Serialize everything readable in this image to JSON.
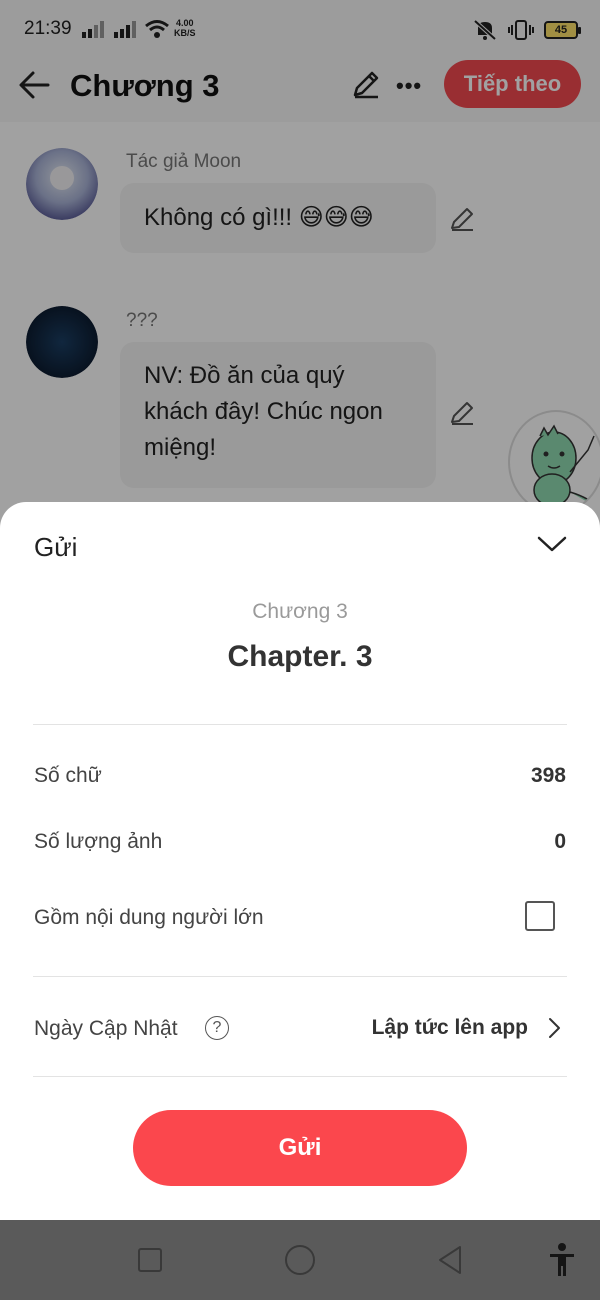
{
  "status_bar": {
    "time": "21:39",
    "net_speed_value": "4.00",
    "net_speed_unit": "KB/S",
    "battery": "45"
  },
  "top_bar": {
    "title": "Chương 3",
    "next_label": "Tiếp theo"
  },
  "messages": [
    {
      "author": "Tác giả Moon",
      "text": "Không có gì!!! 😅😅😅"
    },
    {
      "author": "???",
      "text": "NV: Đồ ăn của quý khách đây! Chúc ngon miệng!"
    }
  ],
  "sheet": {
    "title": "Gửi",
    "chapter_subtitle": "Chương 3",
    "chapter_title": "Chapter. 3",
    "word_count_label": "Số chữ",
    "word_count_value": "398",
    "image_count_label": "Số lượng ảnh",
    "image_count_value": "0",
    "adult_content_label": "Gồm nội dung người lớn",
    "adult_content_checked": false,
    "update_date_label": "Ngày Cập Nhật",
    "update_date_value": "Lập tức lên app",
    "help_glyph": "?",
    "send_label": "Gửi"
  },
  "colors": {
    "accent": "#fb474d",
    "overlay": "rgba(0,0,0,0.37)"
  },
  "icons": [
    "back-arrow-icon",
    "pencil-icon",
    "more-icon",
    "chevron-down-icon",
    "help-icon",
    "chevron-right-icon",
    "nav-recents-icon",
    "nav-home-icon",
    "nav-back-icon",
    "accessibility-icon"
  ]
}
